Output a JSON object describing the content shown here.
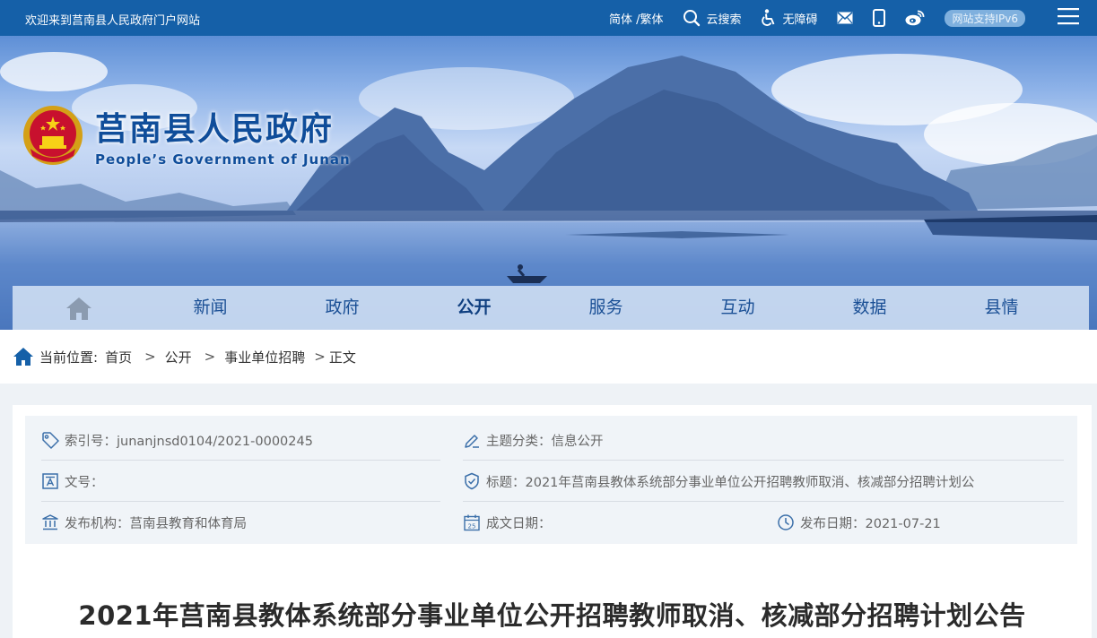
{
  "topbar": {
    "welcome": "欢迎来到莒南县人民政府门户网站",
    "lang": "简体 /繁体",
    "search": "云搜索",
    "accessibility": "无障碍",
    "ipv6": "网站支持IPv6"
  },
  "logo": {
    "cn": "莒南县人民政府",
    "en": "People’s Government of Junan"
  },
  "nav": [
    "新闻",
    "政府",
    "公开",
    "服务",
    "互动",
    "数据",
    "县情"
  ],
  "nav_active": "公开",
  "breadcrumb": {
    "label": "当前位置:",
    "items": [
      "首页",
      "公开",
      "事业单位招聘",
      "正文"
    ],
    "separator": ">"
  },
  "meta": {
    "index_no": "索引号：junanjnsd0104/2021-0000245",
    "topic": "主题分类：信息公开",
    "doc_no": "文号：",
    "title": "标题：2021年莒南县教体系统部分事业单位公开招聘教师取消、核减部分招聘计划公",
    "publisher": "发布机构：莒南县教育和体育局",
    "written_date": "成文日期：",
    "publish_date": "发布日期：2021-07-21",
    "calendar_day": "25"
  },
  "article": {
    "title": "2021年莒南县教体系统部分事业单位公开招聘教师取消、核减部分招聘计划公告"
  },
  "colors": {
    "topbar": "#1560a8",
    "nav_text": "#1a4f95",
    "brand": "#0f4d9a"
  }
}
